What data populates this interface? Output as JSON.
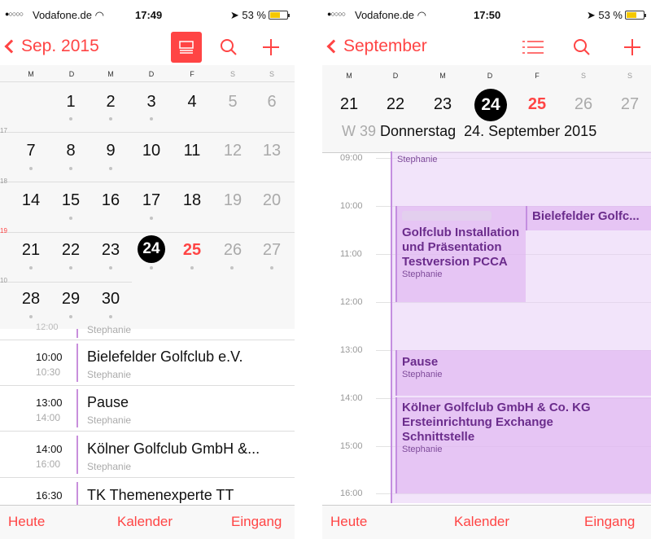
{
  "left": {
    "status": {
      "signal": "●○○○○",
      "carrier": "Vodafone.de",
      "time": "17:49",
      "battery": "53 %"
    },
    "nav": {
      "back_label": "Sep. 2015"
    },
    "weekday_headers": [
      "M",
      "D",
      "M",
      "D",
      "F",
      "S",
      "S"
    ],
    "week_numbers": [
      "17",
      "18",
      "19",
      "10"
    ],
    "weeks": [
      [
        "",
        "",
        "",
        "1",
        "2",
        "3",
        "4",
        "5",
        "6"
      ],
      [
        "7",
        "8",
        "9",
        "10",
        "11",
        "12",
        "13"
      ],
      [
        "14",
        "15",
        "16",
        "17",
        "18",
        "19",
        "20"
      ],
      [
        "21",
        "22",
        "23",
        "24",
        "25",
        "26",
        "27"
      ],
      [
        "28",
        "29",
        "30"
      ]
    ],
    "today": "24",
    "events": [
      {
        "start": "10:00",
        "end": "10:30",
        "title": "Bielefelder Golfclub e.V.",
        "who": "Stephanie"
      },
      {
        "start": "13:00",
        "end": "14:00",
        "title": "Pause",
        "who": "Stephanie"
      },
      {
        "start": "14:00",
        "end": "16:00",
        "title": "Kölner Golfclub GmbH &...",
        "who": "Stephanie"
      },
      {
        "start": "16:30",
        "end": "",
        "title": "TK Themenexperte TT",
        "who": ""
      }
    ],
    "partial_top": {
      "time": "12:00",
      "who": "Stephanie"
    },
    "tabs": {
      "today": "Heute",
      "calendar": "Kalender",
      "inbox": "Eingang"
    }
  },
  "right": {
    "status": {
      "signal": "●○○○○",
      "carrier": "Vodafone.de",
      "time": "17:50",
      "battery": "53 %"
    },
    "nav": {
      "back_label": "September"
    },
    "weekday_headers": [
      "M",
      "D",
      "M",
      "D",
      "F",
      "S",
      "S"
    ],
    "week_days": [
      "21",
      "22",
      "23",
      "24",
      "25",
      "26",
      "27"
    ],
    "week_label": "W 39",
    "day_title": "Donnerstag  24. September 2015",
    "hours": [
      "09:00",
      "10:00",
      "11:00",
      "12:00",
      "13:00",
      "14:00",
      "15:00",
      "16:00"
    ],
    "events": {
      "allday_who": "Stephanie",
      "golf_title": "Golfclub Installation und Präsentation Testversion PCCA",
      "golf_who": "Stephanie",
      "bielefeld_title": "Bielefelder Golfc...",
      "pause_title": "Pause",
      "pause_who": "Stephanie",
      "koeln_title": "Kölner Golfclub GmbH & Co. KG Ersteinrichtung Exchange Schnittstelle",
      "koeln_who": "Stephanie"
    },
    "tabs": {
      "today": "Heute",
      "calendar": "Kalender",
      "inbox": "Eingang"
    }
  },
  "colors": {
    "accent": "#ff4444",
    "event_fill": "#ddb0f0",
    "event_text": "#6b2c8c"
  }
}
